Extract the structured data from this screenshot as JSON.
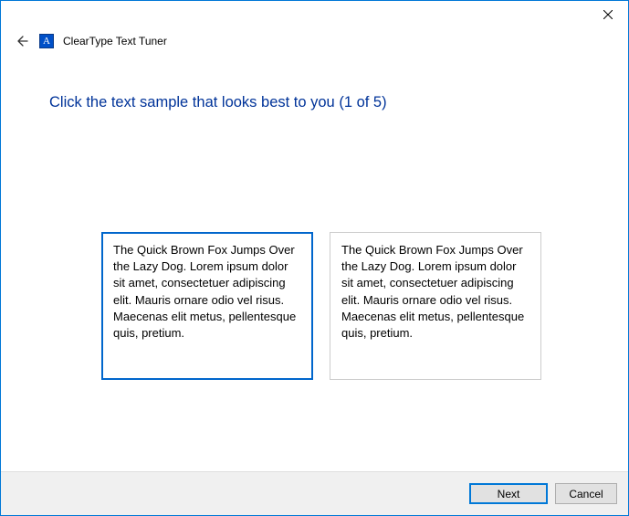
{
  "window": {
    "app_title": "ClearType Text Tuner",
    "app_icon_letter": "A"
  },
  "instruction": "Click the text sample that looks best to you (1 of 5)",
  "samples": [
    {
      "text": "The Quick Brown Fox Jumps Over the Lazy Dog. Lorem ipsum dolor sit amet, consectetuer adipiscing elit. Mauris ornare odio vel risus. Maecenas elit metus, pellentesque quis, pretium.",
      "selected": true
    },
    {
      "text": "The Quick Brown Fox Jumps Over the Lazy Dog. Lorem ipsum dolor sit amet, consectetuer adipiscing elit. Mauris ornare odio vel risus. Maecenas elit metus, pellentesque quis, pretium.",
      "selected": false
    }
  ],
  "footer": {
    "next_label": "Next",
    "cancel_label": "Cancel"
  }
}
